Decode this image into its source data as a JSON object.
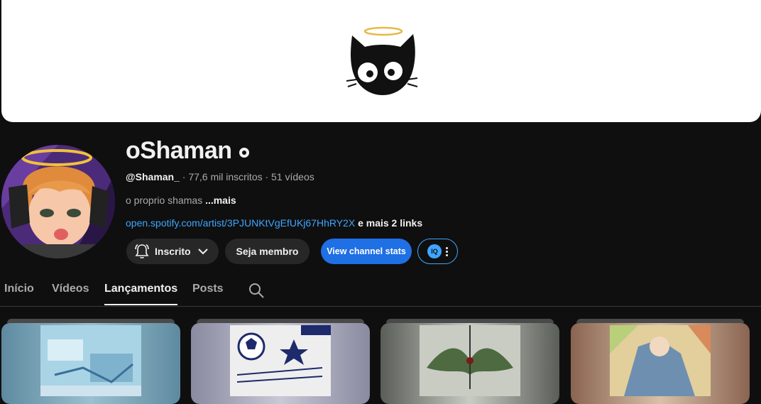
{
  "channel": {
    "name": "oShaman",
    "handle": "@Shaman_",
    "stats": " · 77,6 mil inscritos · 51 vídeos",
    "description": "o proprio shamas ",
    "description_more": "...mais",
    "link_url": "open.spotify.com/artist/3PJUNKtVgEfUKj67HhRY2X",
    "link_more": " e mais 2 links"
  },
  "actions": {
    "subscribe_label": "Inscrito",
    "join_label": "Seja membro",
    "stats_label": "View channel stats",
    "iq_label": "IQ"
  },
  "tabs": [
    {
      "label": "Início",
      "active": false
    },
    {
      "label": "Vídeos",
      "active": false
    },
    {
      "label": "Lançamentos",
      "active": true
    },
    {
      "label": "Posts",
      "active": false
    }
  ],
  "icons": {
    "verified": "verified-badge-icon",
    "bell": "bell-icon",
    "chevron": "chevron-down-icon",
    "search": "search-icon",
    "more": "more-vert-icon"
  },
  "colors": {
    "background": "#0f0f0f",
    "link": "#3ea6ff",
    "stats_button": "#1f6fe5",
    "chip": "#272727"
  }
}
